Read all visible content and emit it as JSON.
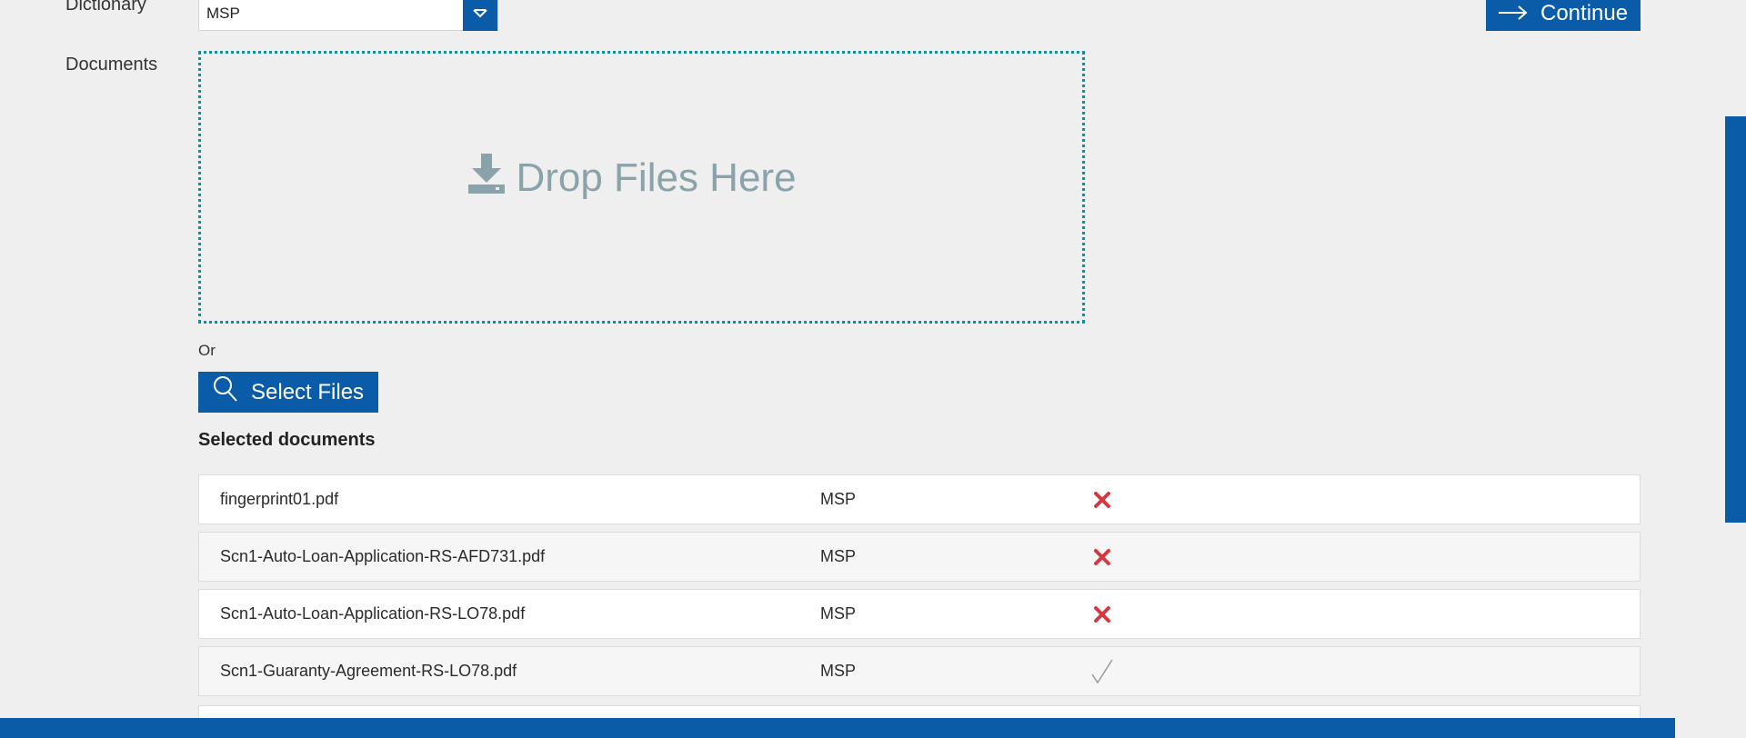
{
  "form": {
    "dictionary_label": "Dictionary",
    "dictionary_value": "MSP",
    "documents_label": "Documents",
    "continue_label": "Continue",
    "dropzone_text": "Drop Files Here",
    "or_text": "Or",
    "select_files_label": "Select Files",
    "selected_heading": "Selected documents"
  },
  "documents": [
    {
      "name": "fingerprint01.pdf",
      "dictionary": "MSP",
      "status": "error"
    },
    {
      "name": "Scn1-Auto-Loan-Application-RS-AFD731.pdf",
      "dictionary": "MSP",
      "status": "error"
    },
    {
      "name": "Scn1-Auto-Loan-Application-RS-LO78.pdf",
      "dictionary": "MSP",
      "status": "error"
    },
    {
      "name": "Scn1-Guaranty-Agreement-RS-LO78.pdf",
      "dictionary": "MSP",
      "status": "ok"
    }
  ],
  "colors": {
    "accent": "#0a5ca8",
    "dropzone_border": "#1e8a93",
    "error": "#d7373f",
    "ok": "#9a9a9a"
  },
  "icons": {
    "dropdown": "caret-down-icon",
    "continue": "arrow-right-icon",
    "dropzone": "download-icon",
    "select_files": "search-icon",
    "error": "x-mark-icon",
    "ok": "check-mark-icon"
  }
}
